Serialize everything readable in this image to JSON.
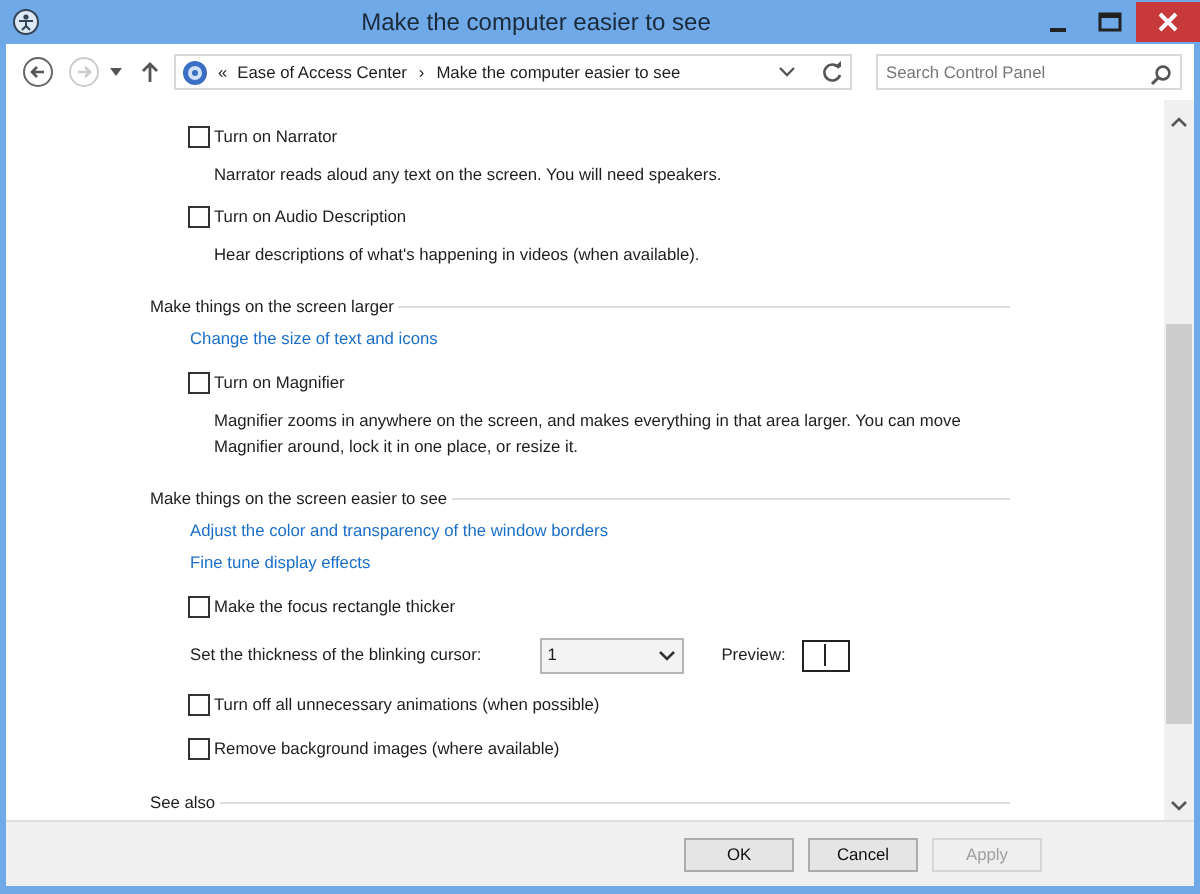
{
  "window": {
    "title": "Make the computer easier to see"
  },
  "address": {
    "overflow": "«",
    "crumbs": [
      "Ease of Access Center",
      "Make the computer easier to see"
    ],
    "separator": "›"
  },
  "search": {
    "placeholder": "Search Control Panel"
  },
  "items": [
    {
      "kind": "checkbox",
      "label": "Turn on Narrator",
      "checked": false
    },
    {
      "kind": "description",
      "text": "Narrator reads aloud any text on the screen. You will need speakers."
    },
    {
      "kind": "checkbox",
      "label": "Turn on Audio Description",
      "checked": false
    },
    {
      "kind": "description",
      "text": "Hear descriptions of what's happening in videos (when available)."
    },
    {
      "kind": "heading",
      "text": "Make things on the screen larger"
    },
    {
      "kind": "link",
      "text": "Change the size of text and icons"
    },
    {
      "kind": "checkbox",
      "label": "Turn on Magnifier",
      "checked": false
    },
    {
      "kind": "description",
      "text": "Magnifier zooms in anywhere on the screen, and makes everything in that area larger. You can move Magnifier around, lock it in one place, or resize it."
    },
    {
      "kind": "heading",
      "text": "Make things on the screen easier to see"
    },
    {
      "kind": "link",
      "text": "Adjust the color and transparency of the window borders"
    },
    {
      "kind": "link",
      "text": "Fine tune display effects"
    },
    {
      "kind": "checkbox",
      "label": "Make the focus rectangle thicker",
      "checked": false
    },
    {
      "kind": "select",
      "label": "Set the thickness of the blinking cursor:",
      "value": "1",
      "preview_label": "Preview:"
    },
    {
      "kind": "checkbox",
      "label": "Turn off all unnecessary animations (when possible)",
      "checked": false
    },
    {
      "kind": "checkbox",
      "label": "Remove background images (where available)",
      "checked": false
    },
    {
      "kind": "heading",
      "text": "See also"
    }
  ],
  "buttons": [
    {
      "label": "OK",
      "disabled": false
    },
    {
      "label": "Cancel",
      "disabled": false
    },
    {
      "label": "Apply",
      "disabled": true
    }
  ]
}
